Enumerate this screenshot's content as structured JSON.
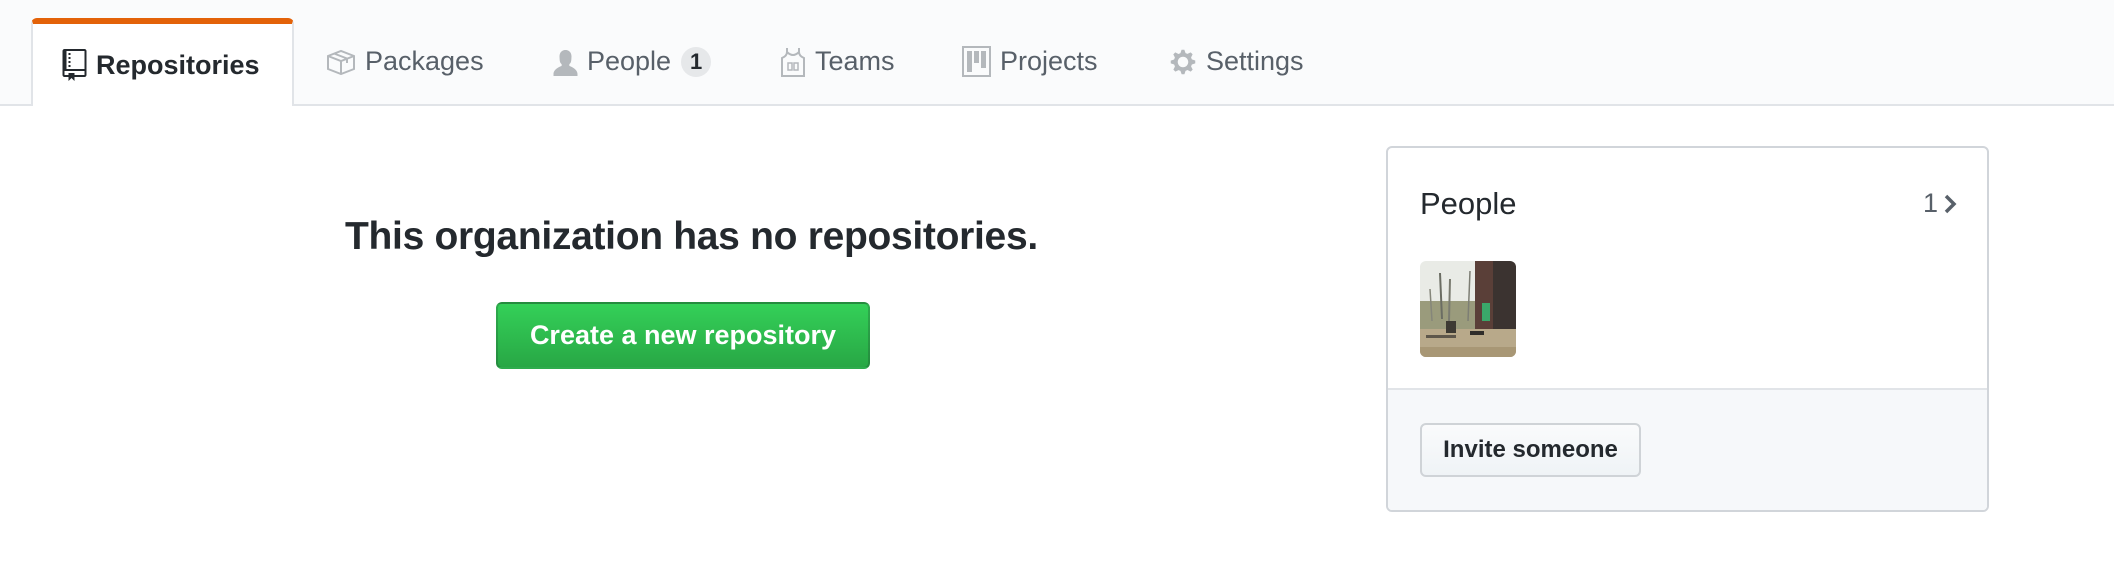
{
  "nav": {
    "tabs": [
      {
        "label": "Repositories",
        "icon": "repo-icon",
        "active": true
      },
      {
        "label": "Packages",
        "icon": "package-icon",
        "active": false
      },
      {
        "label": "People",
        "icon": "person-icon",
        "active": false,
        "count": "1"
      },
      {
        "label": "Teams",
        "icon": "jersey-icon",
        "active": false
      },
      {
        "label": "Projects",
        "icon": "project-icon",
        "active": false
      },
      {
        "label": "Settings",
        "icon": "gear-icon",
        "active": false
      }
    ],
    "accent_color": "#e36209"
  },
  "main": {
    "empty_title": "This organization has no repositories.",
    "create_button_label": "Create a new repository",
    "button_color": "#28a745"
  },
  "people_card": {
    "title": "People",
    "count": "1",
    "members": [
      {
        "avatar": "member-avatar-photo"
      }
    ],
    "invite_button_label": "Invite someone"
  }
}
